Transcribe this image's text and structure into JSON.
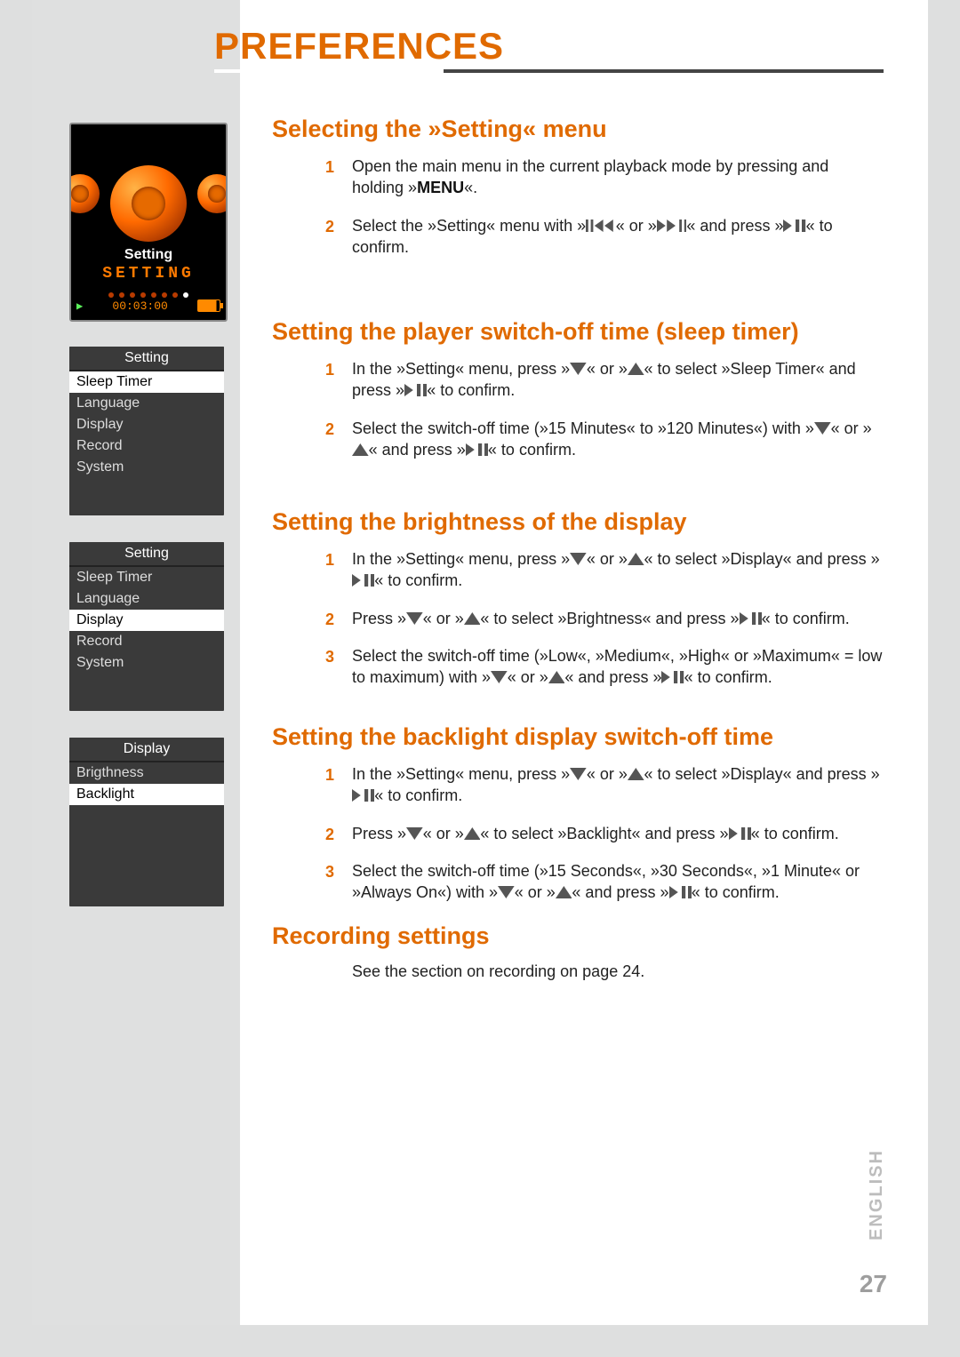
{
  "page": {
    "title": "PREFERENCES",
    "language_tab": "ENGLISH",
    "page_number": "27"
  },
  "device_screen": {
    "label_small": "Setting",
    "label_big": "SETTING",
    "time": "00:03:00"
  },
  "mini_menu_1": {
    "header": "Setting",
    "items": [
      "Sleep Timer",
      "Language",
      "Display",
      "Record",
      "System"
    ],
    "selected_index": 0
  },
  "mini_menu_2": {
    "header": "Setting",
    "items": [
      "Sleep Timer",
      "Language",
      "Display",
      "Record",
      "System"
    ],
    "selected_index": 2
  },
  "mini_menu_3": {
    "header": "Display",
    "items": [
      "Brigthness",
      "Backlight"
    ],
    "selected_index": 1
  },
  "sections": {
    "select_menu": {
      "heading": "Selecting the »Setting« menu",
      "step1_a": "Open the main menu in the current playback mode by pressing and holding »",
      "step1_menu": "MENU",
      "step1_b": "«.",
      "step2_a": "Select the »Setting« menu with »",
      "step2_b": "« or »",
      "step2_c": "« and press »",
      "step2_d": "« to confirm."
    },
    "sleep_timer": {
      "heading": "Setting the player switch-off time (sleep timer)",
      "step1_a": "In the »Setting« menu, press »",
      "step1_b": "« or »",
      "step1_c": "« to select »Sleep Timer« and press »",
      "step1_d": "« to confirm.",
      "step2_a": "Select the switch-off time (»15 Minutes« to »120 Minutes«) with »",
      "step2_b": "« or »",
      "step2_c": "« and press »",
      "step2_d": "« to confirm."
    },
    "brightness": {
      "heading": "Setting the brightness of the display",
      "step1_a": "In the »Setting« menu, press »",
      "step1_b": "« or »",
      "step1_c": "« to select »Display« and press »",
      "step1_d": "« to confirm.",
      "step2_a": "Press »",
      "step2_b": "« or »",
      "step2_c": "« to select »Brightness« and press »",
      "step2_d": "« to confirm.",
      "step3_a": "Select the switch-off time (»Low«, »Medium«, »High« or »Maximum« = low to maximum) with »",
      "step3_b": "« or »",
      "step3_c": "« and press »",
      "step3_d": "« to confirm."
    },
    "backlight": {
      "heading": "Setting the backlight display switch-off time",
      "step1_a": "In the »Setting« menu, press »",
      "step1_b": "« or »",
      "step1_c": "« to select »Display« and press »",
      "step1_d": "« to confirm.",
      "step2_a": "Press »",
      "step2_b": "« or »",
      "step2_c": "« to select »Backlight« and press »",
      "step2_d": "« to confirm.",
      "step3_a": "Select the switch-off time (»15 Seconds«, »30 Seconds«, »1 Minute« or »Always On«) with »",
      "step3_b": "« or »",
      "step3_c": "« and press »",
      "step3_d": "« to confirm."
    },
    "recording": {
      "heading": "Recording settings",
      "text": "See the section on recording on page 24."
    }
  },
  "icons": {
    "prev": "prev-track-icon",
    "next": "next-track-icon",
    "playpause": "play-pause-icon",
    "down": "down-triangle-icon",
    "up": "up-triangle-icon"
  }
}
